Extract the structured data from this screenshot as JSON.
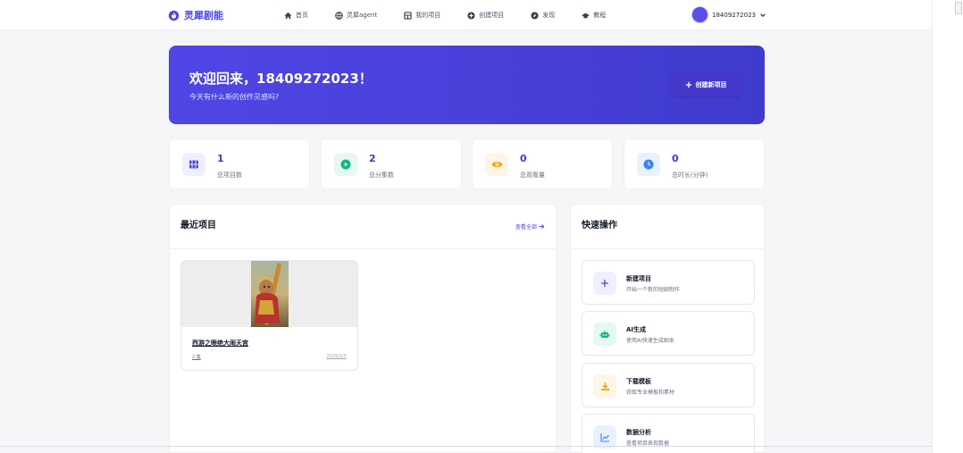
{
  "brand": {
    "name": "灵犀剧能"
  },
  "nav": {
    "items": [
      {
        "label": "首页",
        "icon": "home-icon"
      },
      {
        "label": "灵犀agent",
        "icon": "globe-icon"
      },
      {
        "label": "我的项目",
        "icon": "grid-icon"
      },
      {
        "label": "创建项目",
        "icon": "plus-circle-icon"
      },
      {
        "label": "发现",
        "icon": "compass-icon"
      },
      {
        "label": "教程",
        "icon": "graduation-cap-icon"
      }
    ]
  },
  "user": {
    "name": "18409272023"
  },
  "hero": {
    "title": "欢迎回来，18409272023！",
    "subtitle": "今天有什么新的创作灵感吗?",
    "create_button": "创建新项目"
  },
  "stats": [
    {
      "value": "1",
      "label": "总项目数",
      "icon": "film-icon",
      "color": "#4f46e5",
      "bg": "#eef0ff"
    },
    {
      "value": "2",
      "label": "总分集数",
      "icon": "play-icon",
      "color": "#10b981",
      "bg": "#e7f8f1"
    },
    {
      "value": "0",
      "label": "总观看量",
      "icon": "eye-icon",
      "color": "#f59e0b",
      "bg": "#fff5e6"
    },
    {
      "value": "0",
      "label": "总时长(分钟)",
      "icon": "clock-icon",
      "color": "#3b82f6",
      "bg": "#e8f1ff"
    }
  ],
  "recent": {
    "title": "最近项目",
    "view_all": "查看全部",
    "projects": [
      {
        "name": "西游之眼绝大闹天宫",
        "episodes": "2 集",
        "date": "2025/2/5"
      }
    ]
  },
  "quick": {
    "title": "快速操作",
    "items": [
      {
        "name": "新建项目",
        "desc": "开始一个新的短剧制作",
        "icon": "plus-icon",
        "color": "#4f46e5",
        "bg": "#eef0ff"
      },
      {
        "name": "AI生成",
        "desc": "使用AI快速生成剧本",
        "icon": "robot-icon",
        "color": "#10b981",
        "bg": "#e7f8f1"
      },
      {
        "name": "下载模板",
        "desc": "获取专业模板和素材",
        "icon": "download-icon",
        "color": "#f59e0b",
        "bg": "#fff5e6"
      },
      {
        "name": "数据分析",
        "desc": "查看项目表现数据",
        "icon": "chart-line-icon",
        "color": "#3b82f6",
        "bg": "#e8f1ff"
      }
    ]
  }
}
